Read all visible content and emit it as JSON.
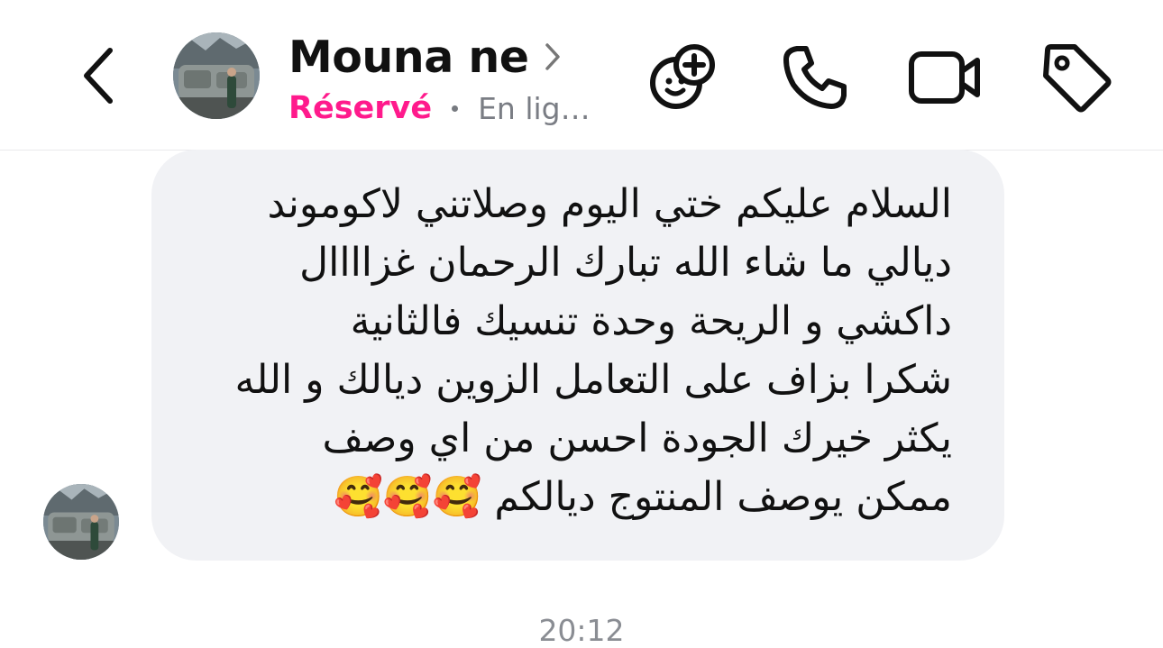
{
  "header": {
    "contact_name": "Mouna ne",
    "status_label": "Réservé",
    "presence": "En lig…",
    "back_icon": "chevron-left-icon",
    "actions": [
      {
        "name": "add-people-button",
        "icon": "add-people-icon"
      },
      {
        "name": "call-button",
        "icon": "phone-icon"
      },
      {
        "name": "video-call-button",
        "icon": "video-camera-icon"
      },
      {
        "name": "label-button",
        "icon": "tag-icon"
      }
    ],
    "accent_color": "#ff1a8c"
  },
  "conversation": {
    "messages": [
      {
        "sender": "incoming",
        "lines": [
          "السلام عليكم ختي اليوم وصلاتني لاكوموند",
          "ديالي ما شاء الله تبارك الرحمان غزاااال",
          "داكشي و الريحة وحدة تنسيك فالثانية",
          "شكرا بزاف على التعامل الزوين ديالك و الله",
          "يكثر خيرك الجودة احسن من اي وصف",
          "ممكن يوصف المنتوج ديالكم 🥰🥰🥰"
        ]
      }
    ],
    "timestamp": "20:12",
    "bubble_color": "#f1f2f5"
  }
}
